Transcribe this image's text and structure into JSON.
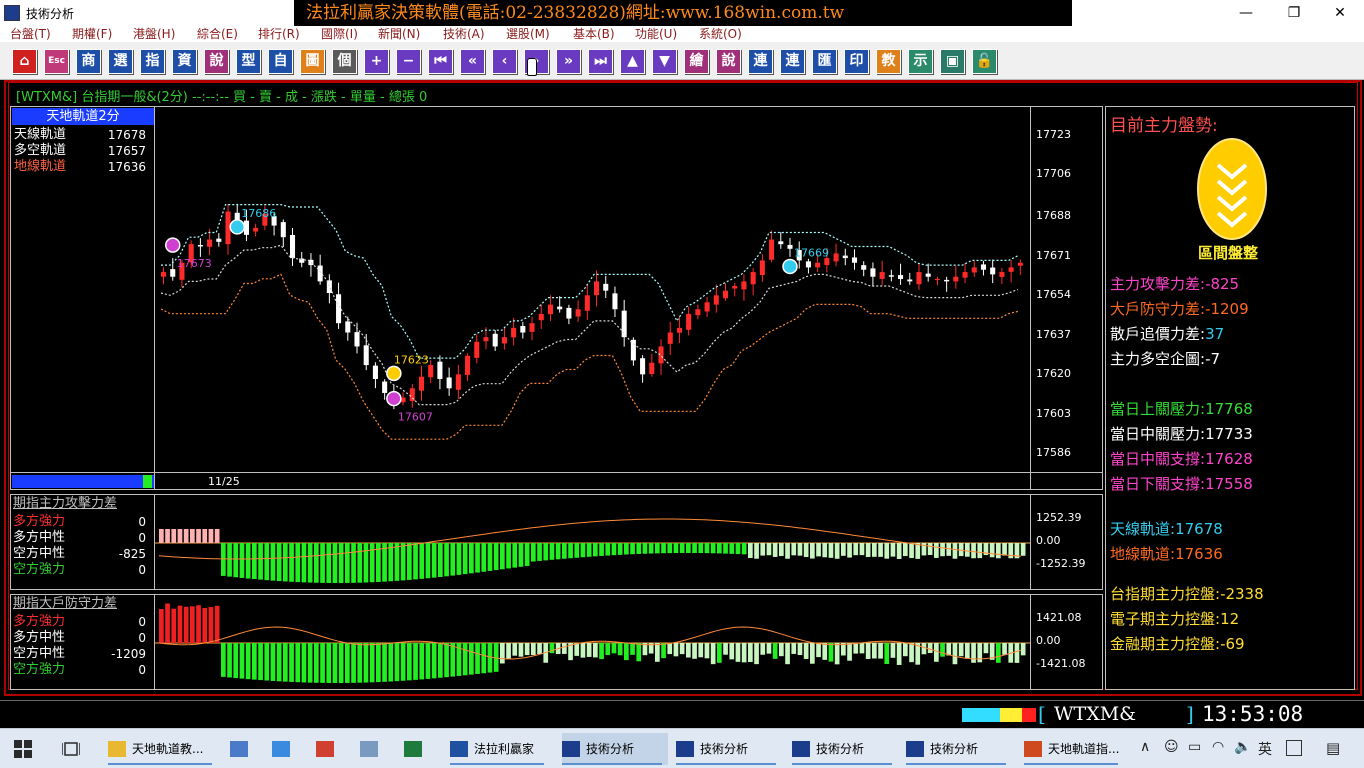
{
  "window": {
    "title": "技術分析",
    "banner": "法拉利贏家決策軟體(電話:02-23832828)網址:www.168win.com.tw"
  },
  "menu": [
    "台盤(T)",
    "期權(F)",
    "港盤(H)",
    "綜合(E)",
    "排行(R)",
    "國際(I)",
    "新聞(N)",
    "技術(A)",
    "選股(M)",
    "基本(B)",
    "功能(U)",
    "系統(O)"
  ],
  "toolbar": [
    {
      "icon": "home-icon",
      "glyph": "⌂",
      "color": "#d02020"
    },
    {
      "icon": "esc-icon",
      "glyph": "Esc",
      "color": "#c03a7a"
    },
    {
      "icon": "merchandise-icon",
      "glyph": "商",
      "color": "#1e4fa8"
    },
    {
      "icon": "select-icon",
      "glyph": "選",
      "color": "#1e4fa8"
    },
    {
      "icon": "index-icon",
      "glyph": "指",
      "color": "#1e4fa8"
    },
    {
      "icon": "data-icon",
      "glyph": "資",
      "color": "#1e4fa8"
    },
    {
      "icon": "quote-icon",
      "glyph": "說",
      "color": "#a0307a"
    },
    {
      "icon": "type-icon",
      "glyph": "型",
      "color": "#1e4fa8"
    },
    {
      "icon": "custom-icon",
      "glyph": "自",
      "color": "#1e4fa8"
    },
    {
      "icon": "chart-icon",
      "glyph": "圖",
      "color": "#e0801a"
    },
    {
      "icon": "list-icon",
      "glyph": "個",
      "color": "#5a5a5a"
    },
    {
      "icon": "plus-icon",
      "glyph": "+",
      "color": "#6a3ac0"
    },
    {
      "icon": "minus-icon",
      "glyph": "−",
      "color": "#6a3ac0"
    },
    {
      "icon": "first-icon",
      "glyph": "⏮",
      "color": "#6a3ac0"
    },
    {
      "icon": "rewind-icon",
      "glyph": "«",
      "color": "#6a3ac0"
    },
    {
      "icon": "prev-icon",
      "glyph": "‹",
      "color": "#6a3ac0"
    },
    {
      "icon": "next-icon",
      "glyph": "›",
      "color": "#6a3ac0"
    },
    {
      "icon": "forward-icon",
      "glyph": "»",
      "color": "#6a3ac0"
    },
    {
      "icon": "last-icon",
      "glyph": "⏭",
      "color": "#6a3ac0"
    },
    {
      "icon": "up-icon",
      "glyph": "▲",
      "color": "#6a3ac0"
    },
    {
      "icon": "down-icon",
      "glyph": "▼",
      "color": "#6a3ac0"
    },
    {
      "icon": "draw-icon",
      "glyph": "繪",
      "color": "#a0307a"
    },
    {
      "icon": "explain-icon",
      "glyph": "說",
      "color": "#a0307a"
    },
    {
      "icon": "link-icon",
      "glyph": "連",
      "color": "#1e4fa8"
    },
    {
      "icon": "link2-icon",
      "glyph": "連",
      "color": "#1e4fa8"
    },
    {
      "icon": "overlay-icon",
      "glyph": "匯",
      "color": "#1e4fa8"
    },
    {
      "icon": "print-icon",
      "glyph": "印",
      "color": "#1e4fa8"
    },
    {
      "icon": "teach-icon",
      "glyph": "教",
      "color": "#e0801a"
    },
    {
      "icon": "demo-icon",
      "glyph": "示",
      "color": "#2a8a6a"
    },
    {
      "icon": "window-icon",
      "glyph": "▣",
      "color": "#2a7a6a"
    },
    {
      "icon": "lock-icon",
      "glyph": "🔓",
      "color": "#2a8a6a"
    }
  ],
  "info_line": "[WTXM&] 台指期一般&(2分)   --:--:-- 買 -  賣 -  成 -  漲跌 -  單量 -  總張 0",
  "main_panel": {
    "header": "天地軌道2分",
    "legend": [
      {
        "label": "天線軌道",
        "value": "17678",
        "color": "#ffffff"
      },
      {
        "label": "多空軌道",
        "value": "17657",
        "color": "#ffffff"
      },
      {
        "label": "地線軌道",
        "value": "17636",
        "color": "#ff6040"
      }
    ],
    "date_label": "11/25",
    "markers": [
      {
        "text": "17686",
        "color": "#33ccee"
      },
      {
        "text": "17673",
        "color": "#d040d0"
      },
      {
        "text": "17623",
        "color": "#ffcc00"
      },
      {
        "text": "17607",
        "color": "#d040d0"
      },
      {
        "text": "17669",
        "color": "#33ccee"
      }
    ]
  },
  "chart_data": {
    "type": "candlestick",
    "y_ticks": [
      "17723",
      "17706",
      "17688",
      "17671",
      "17654",
      "17637",
      "17620",
      "17603",
      "17586"
    ],
    "ylim": [
      17578,
      17735
    ],
    "closes": [
      17664,
      17662,
      17668,
      17676,
      17675,
      17678,
      17677,
      17690,
      17686,
      17680,
      17683,
      17689,
      17684,
      17679,
      17670,
      17668,
      17667,
      17660,
      17655,
      17642,
      17638,
      17632,
      17624,
      17618,
      17612,
      17608,
      17610,
      17614,
      17619,
      17624,
      17618,
      17614,
      17620,
      17628,
      17634,
      17636,
      17632,
      17636,
      17640,
      17638,
      17642,
      17646,
      17650,
      17648,
      17644,
      17648,
      17654,
      17660,
      17656,
      17648,
      17636,
      17626,
      17620,
      17625,
      17632,
      17638,
      17640,
      17646,
      17648,
      17651,
      17654,
      17656,
      17658,
      17660,
      17664,
      17669,
      17678,
      17676,
      17674,
      17669,
      17666,
      17668,
      17670,
      17672,
      17670,
      17668,
      17665,
      17662,
      17664,
      17662,
      17661,
      17660,
      17664,
      17662,
      17661,
      17660,
      17662,
      17664,
      17666,
      17665,
      17663,
      17664,
      17666,
      17668
    ]
  },
  "attack_panel": {
    "title": "期指主力攻擊力差",
    "rows": [
      {
        "label": "多方強力",
        "value": "0",
        "color": "#ff3030"
      },
      {
        "label": "多方中性",
        "value": "0",
        "color": "#ffffff"
      },
      {
        "label": "空方中性",
        "value": "-825",
        "color": "#ffffff"
      },
      {
        "label": "空方強力",
        "value": "0",
        "color": "#33cc33"
      }
    ],
    "ticks": [
      "1252.39",
      "0.00",
      "-1252.39"
    ]
  },
  "defense_panel": {
    "title": "期指大戶防守力差",
    "rows": [
      {
        "label": "多方強力",
        "value": "0",
        "color": "#ff3030"
      },
      {
        "label": "多方中性",
        "value": "0",
        "color": "#ffffff"
      },
      {
        "label": "空方中性",
        "value": "-1209",
        "color": "#ffffff"
      },
      {
        "label": "空方強力",
        "value": "0",
        "color": "#33cc33"
      }
    ],
    "ticks": [
      "1421.08",
      "0.00",
      "-1421.08"
    ]
  },
  "right_panel": {
    "title": "目前主力盤勢:",
    "badge_label": "區間盤整",
    "items": [
      {
        "label": "主力攻擊力差:",
        "value": "-825",
        "color": "#ff44cc",
        "vcolor": "#ff44cc"
      },
      {
        "label": "大戶防守力差:",
        "value": "-1209",
        "color": "#ff6a20",
        "vcolor": "#ff6a20"
      },
      {
        "label": "散戶追價力差:",
        "value": "37",
        "color": "#ffffff",
        "vcolor": "#33ccee"
      },
      {
        "label": "主力多空企圖:",
        "value": "-7",
        "color": "#ffffff",
        "vcolor": "#ffffff"
      },
      {
        "label": "當日上關壓力:",
        "value": "17768",
        "color": "#33dd33",
        "vcolor": "#33dd33"
      },
      {
        "label": "當日中關壓力:",
        "value": "17733",
        "color": "#ffffff",
        "vcolor": "#ffffff"
      },
      {
        "label": "當日中關支撐:",
        "value": "17628",
        "color": "#ff44cc",
        "vcolor": "#ff44cc"
      },
      {
        "label": "當日下關支撐:",
        "value": "17558",
        "color": "#ff44cc",
        "vcolor": "#ff44cc"
      },
      {
        "label": "天線軌道:",
        "value": "17678",
        "color": "#33ccee",
        "vcolor": "#33ccee"
      },
      {
        "label": "地線軌道:",
        "value": "17636",
        "color": "#ff6a20",
        "vcolor": "#ff6a20"
      },
      {
        "label": "台指期主力控盤:",
        "value": "-2338",
        "color": "#ffdd33",
        "vcolor": "#ffdd33"
      },
      {
        "label": "電子期主力控盤:",
        "value": "12",
        "color": "#ffdd33",
        "vcolor": "#ffdd33"
      },
      {
        "label": "金融期主力控盤:",
        "value": "-69",
        "color": "#ffdd33",
        "vcolor": "#ffdd33"
      }
    ]
  },
  "status": {
    "symbol": "WTXM&",
    "time": "13:53:08"
  },
  "taskbar": [
    {
      "label": "天地軌道教...",
      "icon": "folder-icon",
      "color": "#e8b830"
    },
    {
      "label": "",
      "icon": "computer-icon",
      "color": "#4a7ac8"
    },
    {
      "label": "",
      "icon": "ie-icon",
      "color": "#3a8ae0"
    },
    {
      "label": "",
      "icon": "chrome-icon",
      "color": "#d04030"
    },
    {
      "label": "",
      "icon": "paint-icon",
      "color": "#7a9ac0"
    },
    {
      "label": "",
      "icon": "excel-icon",
      "color": "#1f7a3e"
    },
    {
      "label": "法拉利贏家",
      "icon": "ferrari-icon",
      "color": "#2050a0"
    },
    {
      "label": "技術分析",
      "icon": "chart-app-icon",
      "color": "#1c3d8c"
    },
    {
      "label": "技術分析",
      "icon": "chart-app-icon",
      "color": "#1c3d8c"
    },
    {
      "label": "技術分析",
      "icon": "chart-app-icon",
      "color": "#1c3d8c"
    },
    {
      "label": "技術分析",
      "icon": "chart-app-icon",
      "color": "#1c3d8c"
    },
    {
      "label": "天地軌道指...",
      "icon": "powerpoint-icon",
      "color": "#d04a20"
    }
  ],
  "tray": {
    "lang": "英"
  }
}
